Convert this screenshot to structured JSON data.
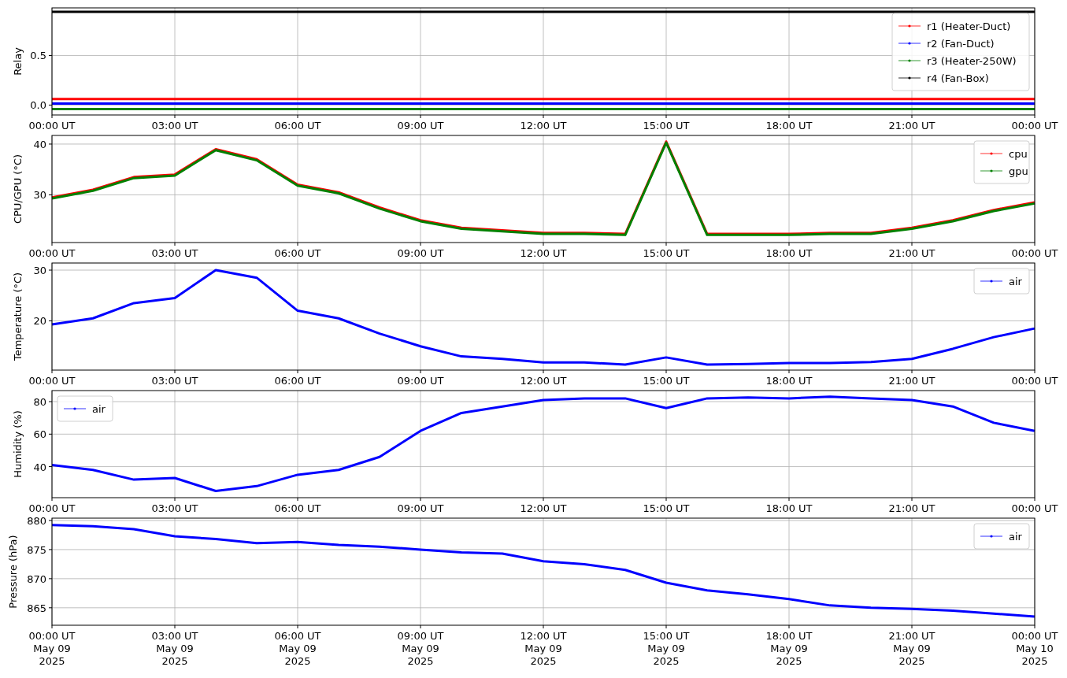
{
  "panels": [
    {
      "chart_data": {
        "type": "line",
        "grid": true,
        "legend": "upper right",
        "ylabel": "Relay",
        "ylim": [
          -0.1,
          0.98
        ],
        "categories": [
          "00:00 UT",
          null,
          null,
          "03:00 UT",
          null,
          null,
          "06:00 UT",
          null,
          null,
          "09:00 UT",
          null,
          null,
          "12:00 UT",
          null,
          null,
          "15:00 UT",
          null,
          null,
          "18:00 UT",
          null,
          null,
          "21:00 UT",
          null,
          null,
          "00:00 UT"
        ],
        "yticks": [
          {
            "value": 0,
            "label": "0.0"
          },
          {
            "value": 0.5,
            "label": "0.5"
          }
        ],
        "series": [
          {
            "name": "r1 (Heater-Duct)",
            "color": "#ff0000",
            "values": [
              0.06,
              0.06,
              0.06,
              0.06,
              0.06,
              0.06,
              0.06,
              0.06,
              0.06,
              0.06,
              0.06,
              0.06,
              0.06,
              0.06,
              0.06,
              0.06,
              0.06,
              0.06,
              0.06,
              0.06,
              0.06,
              0.06,
              0.06,
              0.06,
              0.06
            ]
          },
          {
            "name": "r2 (Fan-Duct)",
            "color": "#0000ff",
            "values": [
              0.015,
              0.015,
              0.015,
              0.015,
              0.015,
              0.015,
              0.015,
              0.015,
              0.015,
              0.015,
              0.015,
              0.015,
              0.015,
              0.015,
              0.015,
              0.015,
              0.015,
              0.015,
              0.015,
              0.015,
              0.015,
              0.015,
              0.015,
              0.015,
              0.015
            ]
          },
          {
            "name": "r3 (Heater-250W)",
            "color": "#008000",
            "values": [
              -0.04,
              -0.04,
              -0.04,
              -0.04,
              -0.04,
              -0.04,
              -0.04,
              -0.04,
              -0.04,
              -0.04,
              -0.04,
              -0.04,
              -0.04,
              -0.04,
              -0.04,
              -0.04,
              -0.04,
              -0.04,
              -0.04,
              -0.04,
              -0.04,
              -0.04,
              -0.04,
              -0.04,
              -0.04
            ]
          },
          {
            "name": "r4 (Fan-Box)",
            "color": "#000000",
            "values": [
              0.94,
              0.94,
              0.94,
              0.94,
              0.94,
              0.94,
              0.94,
              0.94,
              0.94,
              0.94,
              0.94,
              0.94,
              0.94,
              0.94,
              0.94,
              0.94,
              0.94,
              0.94,
              0.94,
              0.94,
              0.94,
              0.94,
              0.94,
              0.94,
              0.94
            ]
          }
        ]
      }
    },
    {
      "chart_data": {
        "type": "line",
        "grid": true,
        "legend": "upper right",
        "ylabel": "CPU/GPU (°C)",
        "ylim": [
          20.6,
          41.7
        ],
        "categories": [
          "00:00 UT",
          null,
          null,
          "03:00 UT",
          null,
          null,
          "06:00 UT",
          null,
          null,
          "09:00 UT",
          null,
          null,
          "12:00 UT",
          null,
          null,
          "15:00 UT",
          null,
          null,
          "18:00 UT",
          null,
          null,
          "21:00 UT",
          null,
          null,
          "00:00 UT"
        ],
        "yticks": [
          30,
          40
        ],
        "series": [
          {
            "name": "cpu",
            "color": "#ff0000",
            "values": [
              29.5,
              31,
              33.5,
              34,
              39,
              37,
              32,
              30.5,
              27.5,
              25,
              23.5,
              23,
              22.5,
              22.5,
              22.3,
              40.5,
              22.3,
              22.3,
              22.3,
              22.5,
              22.5,
              23.5,
              25,
              27,
              28.5
            ]
          },
          {
            "name": "gpu",
            "color": "#008000",
            "values": [
              29.3,
              30.8,
              33.3,
              33.8,
              38.8,
              36.8,
              31.8,
              30.3,
              27.3,
              24.8,
              23.3,
              22.8,
              22.3,
              22.3,
              22.1,
              40.3,
              22.1,
              22.1,
              22.1,
              22.3,
              22.3,
              23.3,
              24.8,
              26.8,
              28.3
            ]
          }
        ]
      }
    },
    {
      "chart_data": {
        "type": "line",
        "grid": true,
        "legend": "upper right",
        "ylabel": "Temperature (°C)",
        "ylim": [
          10.3,
          31.4
        ],
        "categories": [
          "00:00 UT",
          null,
          null,
          "03:00 UT",
          null,
          null,
          "06:00 UT",
          null,
          null,
          "09:00 UT",
          null,
          null,
          "12:00 UT",
          null,
          null,
          "15:00 UT",
          null,
          null,
          "18:00 UT",
          null,
          null,
          "21:00 UT",
          null,
          null,
          "00:00 UT"
        ],
        "yticks": [
          20,
          30
        ],
        "series": [
          {
            "name": "air",
            "color": "#0000ff",
            "values": [
              19.3,
              20.5,
              23.5,
              24.5,
              30,
              28.5,
              22,
              20.5,
              17.5,
              15,
              13,
              12.5,
              11.8,
              11.8,
              11.4,
              12.8,
              11.4,
              11.5,
              11.7,
              11.7,
              11.9,
              12.5,
              14.5,
              16.8,
              18.5
            ]
          }
        ]
      }
    },
    {
      "chart_data": {
        "type": "line",
        "grid": true,
        "legend": "upper left",
        "ylabel": "Humidity (%)",
        "ylim": [
          20.9,
          86.8
        ],
        "categories": [
          "00:00 UT",
          null,
          null,
          "03:00 UT",
          null,
          null,
          "06:00 UT",
          null,
          null,
          "09:00 UT",
          null,
          null,
          "12:00 UT",
          null,
          null,
          "15:00 UT",
          null,
          null,
          "18:00 UT",
          null,
          null,
          "21:00 UT",
          null,
          null,
          "00:00 UT"
        ],
        "yticks": [
          40,
          60,
          80
        ],
        "series": [
          {
            "name": "air",
            "color": "#0000ff",
            "values": [
              41,
              38,
              32,
              33,
              25,
              28,
              35,
              38,
              46,
              62,
              73,
              77,
              81,
              82,
              82,
              76,
              82,
              82.5,
              82,
              83,
              82,
              81,
              77,
              67,
              62
            ]
          }
        ]
      }
    },
    {
      "chart_data": {
        "type": "line",
        "grid": true,
        "legend": "upper right",
        "ylabel": "Pressure (hPa)",
        "ylim": [
          862,
          880.4
        ],
        "categories": [
          "00:00 UT\nMay 09\n2025",
          null,
          null,
          "03:00 UT\nMay 09\n2025",
          null,
          null,
          "06:00 UT\nMay 09\n2025",
          null,
          null,
          "09:00 UT\nMay 09\n2025",
          null,
          null,
          "12:00 UT\nMay 09\n2025",
          null,
          null,
          "15:00 UT\nMay 09\n2025",
          null,
          null,
          "18:00 UT\nMay 09\n2025",
          null,
          null,
          "21:00 UT\nMay 09\n2025",
          null,
          null,
          "00:00 UT\nMay 10\n2025"
        ],
        "yticks": [
          865,
          870,
          875,
          880
        ],
        "series": [
          {
            "name": "air",
            "color": "#0000ff",
            "values": [
              879.2,
              879,
              878.5,
              877.3,
              876.8,
              876.1,
              876.3,
              875.8,
              875.5,
              875,
              874.5,
              874.3,
              873,
              872.5,
              871.5,
              869.3,
              868,
              867.3,
              866.5,
              865.4,
              865,
              864.8,
              864.5,
              864,
              863.5
            ]
          }
        ]
      }
    }
  ]
}
